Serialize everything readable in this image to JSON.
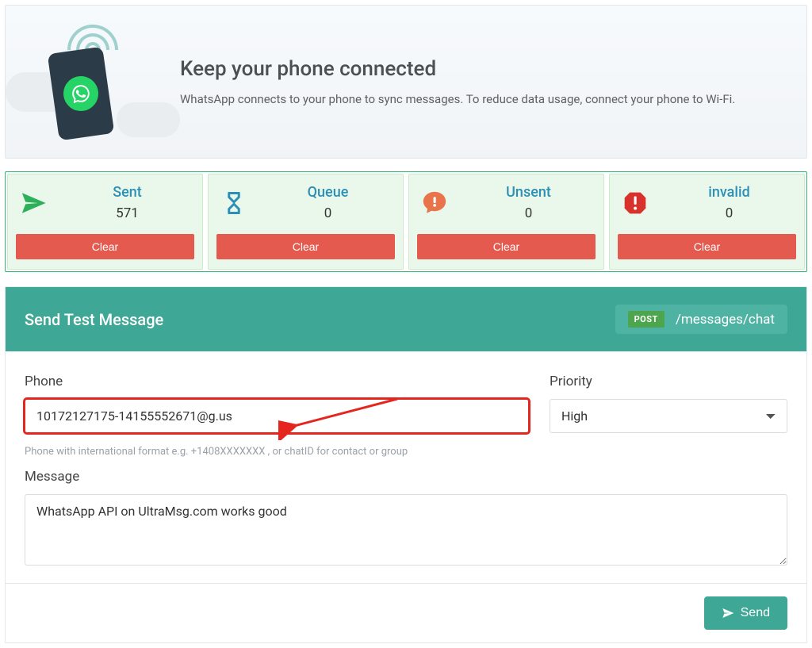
{
  "hero": {
    "title": "Keep your phone connected",
    "subtitle": "WhatsApp connects to your phone to sync messages. To reduce data usage, connect your phone to Wi-Fi."
  },
  "stats": [
    {
      "key": "sent",
      "title": "Sent",
      "value": "571",
      "clear_label": "Clear",
      "icon": "paper-plane",
      "icon_color": "#2eb05a"
    },
    {
      "key": "queue",
      "title": "Queue",
      "value": "0",
      "clear_label": "Clear",
      "icon": "hourglass",
      "icon_color": "#2e8fb5"
    },
    {
      "key": "unsent",
      "title": "Unsent",
      "value": "0",
      "clear_label": "Clear",
      "icon": "chat-alert",
      "icon_color": "#e9744a"
    },
    {
      "key": "invalid",
      "title": "invalid",
      "value": "0",
      "clear_label": "Clear",
      "icon": "stop-alert",
      "icon_color": "#d7322c"
    }
  ],
  "send_panel": {
    "title": "Send Test Message",
    "api": {
      "method": "POST",
      "path": "/messages/chat"
    },
    "phone": {
      "label": "Phone",
      "value": "10172127175-14155552671@g.us",
      "helper": "Phone with international format e.g. +1408XXXXXXX , or chatID for contact or group"
    },
    "priority": {
      "label": "Priority",
      "selected": "High",
      "options": [
        "High"
      ]
    },
    "message": {
      "label": "Message",
      "value": "WhatsApp API on UltraMsg.com works good"
    },
    "send_label": "Send"
  }
}
